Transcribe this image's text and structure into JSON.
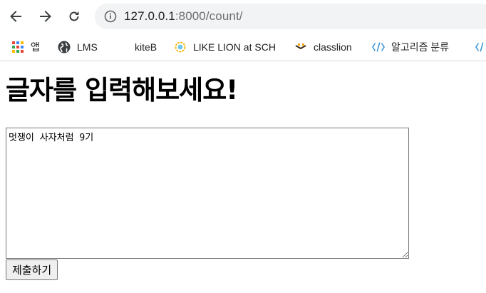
{
  "browser": {
    "url_host": "127.0.0.1",
    "url_rest": ":8000/count/"
  },
  "bookmarks": [
    {
      "label": "앱",
      "icon": "apps-grid-icon"
    },
    {
      "label": "LMS",
      "icon": "globe-icon"
    },
    {
      "label": "kiteB",
      "icon": "none"
    },
    {
      "label": "LIKE LION at SCH",
      "icon": "likelion-icon"
    },
    {
      "label": "classlion",
      "icon": "classlion-icon"
    },
    {
      "label": "알고리즘 분류",
      "icon": "code-icon"
    },
    {
      "label": "",
      "icon": "code-icon"
    }
  ],
  "page": {
    "title": "글자를 입력해보세요!",
    "textarea_value": "멋쟁이 사자처럼 9기",
    "submit_label": "제출하기"
  },
  "colors": {
    "omnibox_bg": "#f1f3f4",
    "code_icon": "#2b8fd6"
  }
}
